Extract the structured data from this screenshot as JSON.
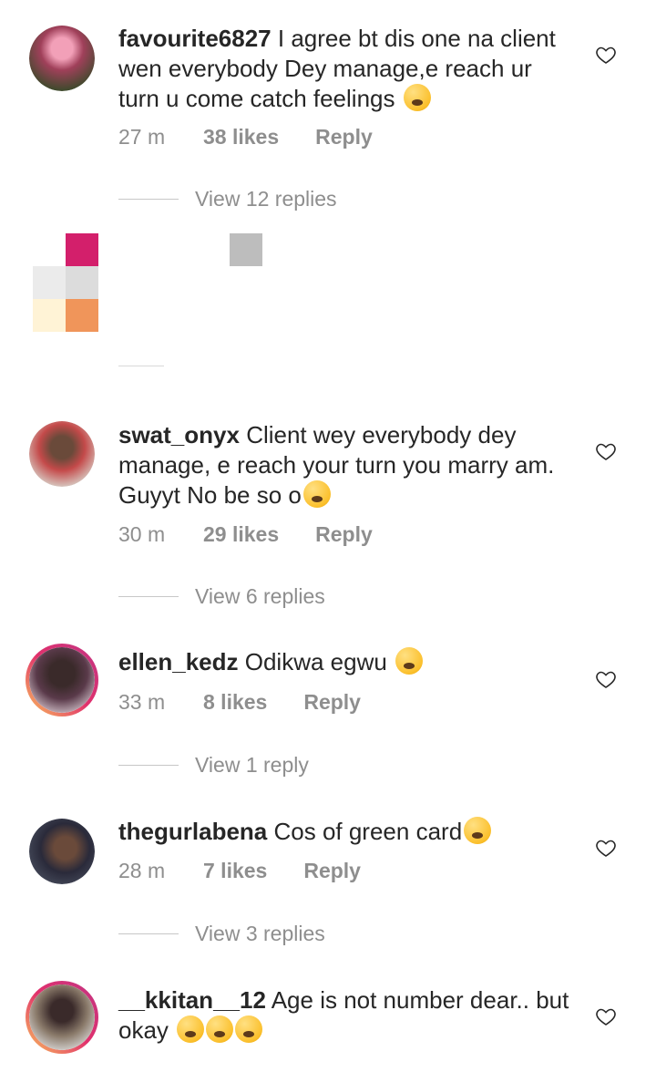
{
  "comments": [
    {
      "username": "favourite6827",
      "text": "I agree bt dis one na client wen everybody Dey manage,e reach ur turn u come catch feelings",
      "emoji": "weary-face-emoji",
      "time": "27 m",
      "likes": "38 likes",
      "reply": "Reply",
      "view_replies": "View 12 replies",
      "avatar_color": "#a0405a"
    },
    {
      "username": "swat_onyx",
      "text": "Client wey everybody dey manage, e reach your turn you marry am. Guyyt No be so o",
      "emoji": "crying-face-emoji",
      "time": "30 m",
      "likes": "29 likes",
      "reply": "Reply",
      "view_replies": "View 6 replies",
      "avatar_color": "#c44a4a"
    },
    {
      "username": "ellen_kedz",
      "text": "Odikwa egwu",
      "emoji": "laughing-tears-emoji",
      "time": "33 m",
      "likes": "8 likes",
      "reply": "Reply",
      "view_replies": "View 1 reply",
      "avatar_color": "#5a3a4a"
    },
    {
      "username": "thegurlabena",
      "text": "Cos of green card",
      "emoji": "laughing-tears-emoji",
      "time": "28 m",
      "likes": "7 likes",
      "reply": "Reply",
      "view_replies": "View 3 replies",
      "avatar_color": "#2a2a3a"
    },
    {
      "username": "__kkitan__12",
      "text": "Age is not number dear.. but okay",
      "emoji": "hushed-face-emoji x3",
      "avatar_color": "#8a7a6a"
    }
  ],
  "colors": {
    "text": "#262626",
    "meta": "#8e8e8e",
    "story_ring": "#e1306c"
  }
}
